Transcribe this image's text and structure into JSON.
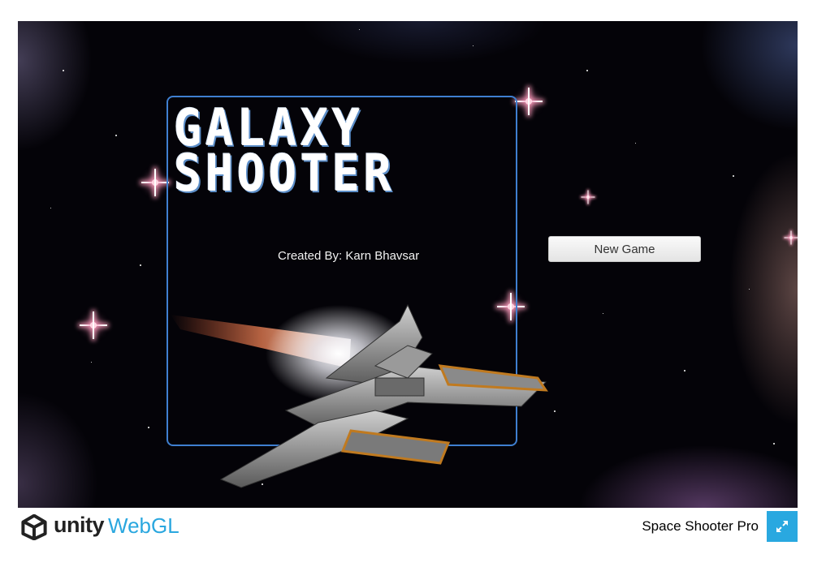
{
  "game": {
    "title_line1": "GALAXY",
    "title_line2": "SHOOTER",
    "credit": "Created By: Karn Bhavsar",
    "new_game_label": "New Game"
  },
  "footer": {
    "brand_unity": "unity",
    "brand_webgl": "WebGL",
    "game_name": "Space Shooter Pro",
    "fullscreen_icon": "fullscreen-icon"
  },
  "colors": {
    "frame_border": "#3f7fd0",
    "title_shadow": "#5c8ec8",
    "webgl_blue": "#2aa7df",
    "fullscreen_bg": "#29a8e0"
  }
}
